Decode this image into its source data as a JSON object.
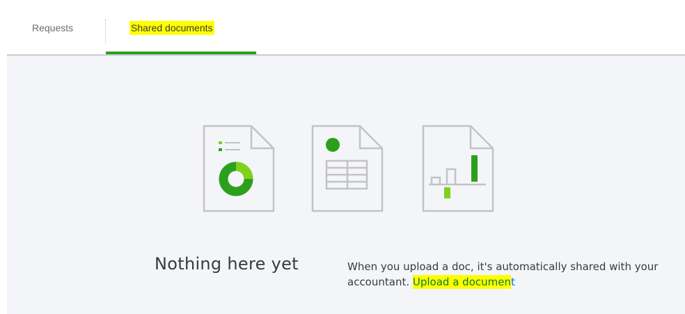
{
  "tabs": {
    "requests_label": "Requests",
    "shared_label": "Shared documents"
  },
  "empty_state": {
    "title": "Nothing here yet",
    "description": "When you upload a doc, it's automatically shared with your accountant.",
    "link_highlighted": "Upload a documen",
    "link_rest": "t"
  },
  "icons": [
    "document-donut-chart-icon",
    "document-spreadsheet-icon",
    "document-bar-chart-icon"
  ],
  "colors": {
    "accent_green": "#2ca01c",
    "light_green": "#7fd11b",
    "highlight": "#ffff00",
    "link": "#0077c5"
  }
}
